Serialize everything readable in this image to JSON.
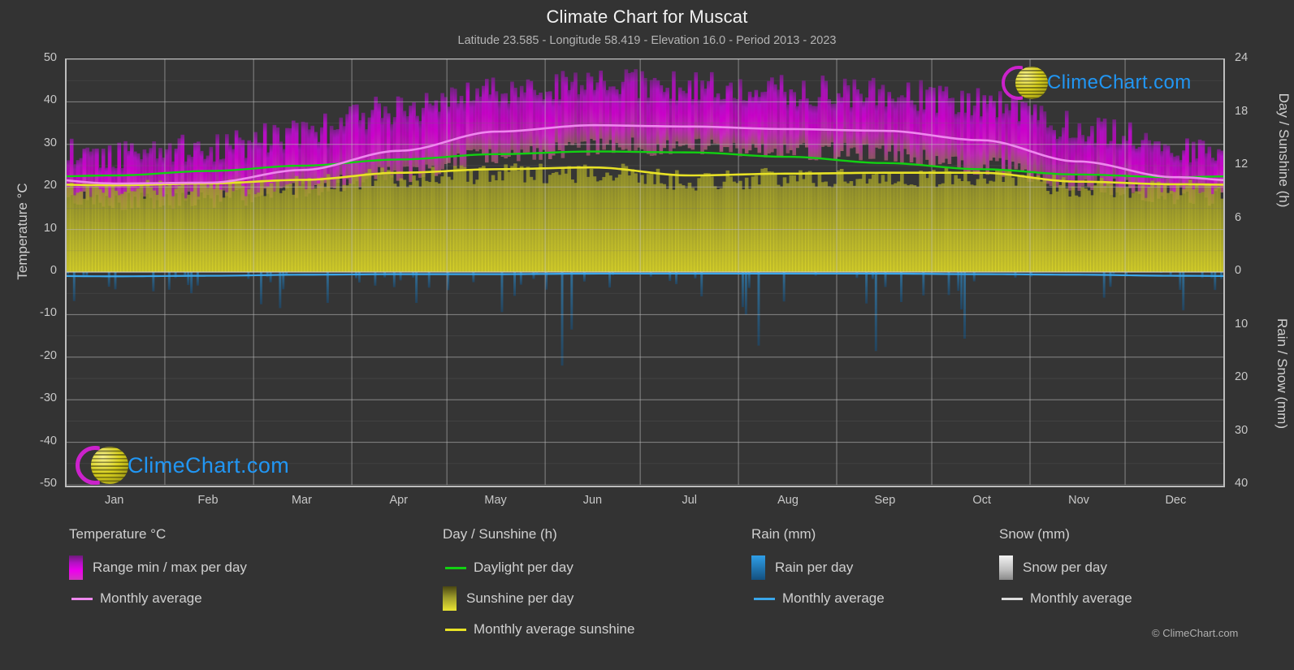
{
  "header": {
    "title": "Climate Chart for Muscat",
    "subtitle": "Latitude 23.585 - Longitude 58.419 - Elevation 16.0 - Period 2013 - 2023"
  },
  "brand": {
    "name": "ClimeChart.com",
    "copyright": "© ClimeChart.com",
    "logo_ring_color": "#cc22cc",
    "logo_ball_color": "#d9d11f",
    "logo_text_color": "#2196f3"
  },
  "axes": {
    "left": {
      "title": "Temperature °C",
      "ticks": [
        "50",
        "40",
        "30",
        "20",
        "10",
        "0",
        "-10",
        "-20",
        "-30",
        "-40",
        "-50"
      ],
      "min": -50,
      "max": 50,
      "step": 10,
      "minor_step": 5
    },
    "right_top": {
      "title": "Day / Sunshine (h)",
      "ticks": [
        "24",
        "18",
        "12",
        "6",
        "0"
      ],
      "min": 0,
      "max": 24,
      "step": 6
    },
    "right_bottom": {
      "title": "Rain / Snow (mm)",
      "ticks": [
        "0",
        "10",
        "20",
        "30",
        "40"
      ],
      "min": 0,
      "max": 40,
      "step": 10
    },
    "x": {
      "ticks": [
        "Jan",
        "Feb",
        "Mar",
        "Apr",
        "May",
        "Jun",
        "Jul",
        "Aug",
        "Sep",
        "Oct",
        "Nov",
        "Dec"
      ]
    }
  },
  "legend": {
    "groups": [
      {
        "title": "Temperature °C",
        "items": [
          {
            "label": "Range min / max per day",
            "style": "box",
            "color": "#e000e0"
          },
          {
            "label": "Monthly average",
            "style": "line",
            "color": "#ee88ee"
          }
        ]
      },
      {
        "title": "Day / Sunshine (h)",
        "items": [
          {
            "label": "Daylight per day",
            "style": "line",
            "color": "#12d012"
          },
          {
            "label": "Sunshine per day",
            "style": "box",
            "color": "#e8e226"
          },
          {
            "label": "Monthly average sunshine",
            "style": "line",
            "color": "#e8e226"
          }
        ]
      },
      {
        "title": "Rain (mm)",
        "items": [
          {
            "label": "Rain per day",
            "style": "box",
            "color": "#1a8fe0"
          },
          {
            "label": "Monthly average",
            "style": "line",
            "color": "#3aa6ea"
          }
        ]
      },
      {
        "title": "Snow (mm)",
        "items": [
          {
            "label": "Snow per day",
            "style": "box",
            "color": "#e8e8e8"
          },
          {
            "label": "Monthly average",
            "style": "line",
            "color": "#dddddd"
          }
        ]
      }
    ]
  },
  "chart_data": {
    "type": "area",
    "title": "Climate Chart for Muscat",
    "subtitle": "Latitude 23.585 - Longitude 58.419 - Elevation 16.0 - Period 2013 - 2023",
    "xlabel": "",
    "ylabel": "Temperature °C",
    "ylim": [
      -50,
      50
    ],
    "y2lim_top": [
      0,
      24
    ],
    "y2lim_bottom": [
      0,
      40
    ],
    "grid": true,
    "legend_position": "below",
    "categories": [
      "Jan",
      "Feb",
      "Mar",
      "Apr",
      "May",
      "Jun",
      "Jul",
      "Aug",
      "Sep",
      "Oct",
      "Nov",
      "Dec"
    ],
    "series": [
      {
        "name": "Monthly average temperature",
        "unit": "°C",
        "axis": "left",
        "color": "#ee88ee",
        "values": [
          20.8,
          21.0,
          24.0,
          28.5,
          33.0,
          34.5,
          34.2,
          33.6,
          33.2,
          31.0,
          26.0,
          22.3
        ]
      },
      {
        "name": "Daily max temperature (range top)",
        "unit": "°C",
        "axis": "left",
        "color": "#e000e0",
        "values": [
          27.0,
          28.0,
          32.0,
          37.5,
          42.0,
          43.5,
          42.5,
          41.5,
          41.0,
          38.5,
          33.0,
          28.5
        ]
      },
      {
        "name": "Daily min temperature (range bottom)",
        "unit": "°C",
        "axis": "left",
        "color": "#e000e0",
        "values": [
          16.5,
          17.0,
          19.5,
          23.0,
          27.5,
          29.5,
          29.5,
          28.5,
          28.0,
          25.0,
          21.0,
          18.0
        ]
      },
      {
        "name": "Daylight per day",
        "unit": "h",
        "axis": "right_top",
        "color": "#12d012",
        "values": [
          10.9,
          11.4,
          12.0,
          12.7,
          13.3,
          13.6,
          13.5,
          13.0,
          12.3,
          11.6,
          11.0,
          10.7
        ]
      },
      {
        "name": "Monthly average sunshine",
        "unit": "h",
        "axis": "right_top",
        "color": "#e8e226",
        "values": [
          9.8,
          10.0,
          10.4,
          11.2,
          11.6,
          11.8,
          10.9,
          11.1,
          11.2,
          11.2,
          10.2,
          9.9
        ]
      },
      {
        "name": "Rain monthly average",
        "unit": "mm",
        "axis": "right_bottom",
        "color": "#3aa6ea",
        "values": [
          0.8,
          0.7,
          0.5,
          0.4,
          0.4,
          0.3,
          0.3,
          0.3,
          0.3,
          0.4,
          0.5,
          0.7
        ]
      },
      {
        "name": "Snow monthly average",
        "unit": "mm",
        "axis": "right_bottom",
        "color": "#dddddd",
        "values": [
          0,
          0,
          0,
          0,
          0,
          0,
          0,
          0,
          0,
          0,
          0,
          0
        ]
      }
    ]
  }
}
